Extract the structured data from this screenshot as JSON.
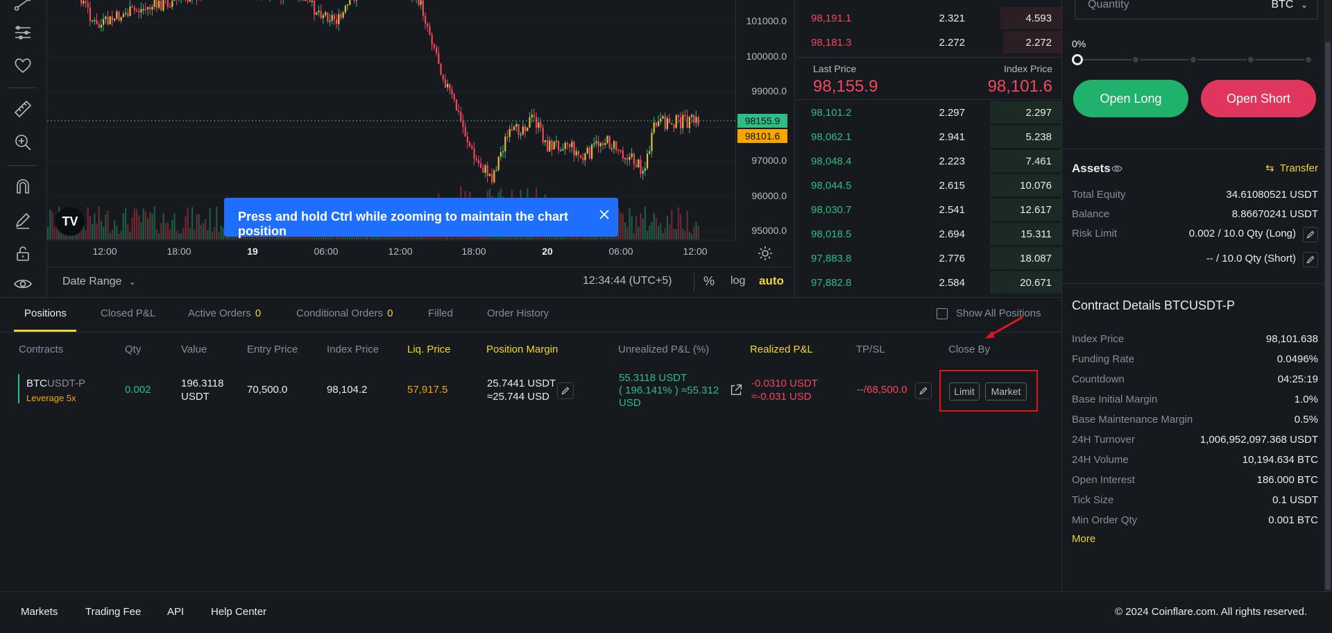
{
  "toast": {
    "message": "Press and hold Ctrl while zooming to maintain the chart position"
  },
  "chart": {
    "price_ticks": [
      "101000.0",
      "100000.0",
      "99000.0",
      "98155.9",
      "98101.6",
      "97000.0",
      "96000.0",
      "95000.0"
    ],
    "time_ticks": [
      "12:00",
      "18:00",
      "19",
      "06:00",
      "12:00",
      "18:00",
      "20",
      "06:00",
      "12:00"
    ],
    "date_range_label": "Date Range",
    "clock": "12:34:44 (UTC+5)",
    "pct_label": "%",
    "log_label": "log",
    "auto_label": "auto",
    "logo_text": "TV",
    "colors": {
      "up": "#2ebd85",
      "down": "#f6465d",
      "candle_up": "#e8b93b",
      "candle_down": "#f6465d"
    }
  },
  "orderbook": {
    "asks": [
      {
        "price": "98,191.1",
        "size": "2.321",
        "total": "4.593",
        "depth": 0.23
      },
      {
        "price": "98,181.3",
        "size": "2.272",
        "total": "2.272",
        "depth": 0.22
      }
    ],
    "last_price_label": "Last Price",
    "last_price": "98,155.9",
    "index_price_label": "Index Price",
    "index_price": "98,101.6",
    "bids": [
      {
        "price": "98,101.2",
        "size": "2.297",
        "total": "2.297",
        "depth": 0.27
      },
      {
        "price": "98,062.1",
        "size": "2.941",
        "total": "5.238",
        "depth": 0.27
      },
      {
        "price": "98,048.4",
        "size": "2.223",
        "total": "7.461",
        "depth": 0.27
      },
      {
        "price": "98,044.5",
        "size": "2.615",
        "total": "10.076",
        "depth": 0.27
      },
      {
        "price": "98,030.7",
        "size": "2.541",
        "total": "12.617",
        "depth": 0.27
      },
      {
        "price": "98,018.5",
        "size": "2.694",
        "total": "15.311",
        "depth": 0.27
      },
      {
        "price": "97,883.8",
        "size": "2.776",
        "total": "18.087",
        "depth": 0.27
      },
      {
        "price": "97,882.8",
        "size": "2.584",
        "total": "20.671",
        "depth": 0.27
      }
    ]
  },
  "order_form": {
    "quantity_placeholder": "Quantity",
    "quantity_unit": "BTC",
    "slider_label": "0%",
    "slider_value": 0,
    "open_long": "Open Long",
    "open_short": "Open Short"
  },
  "assets": {
    "title": "Assets",
    "transfer_label": "Transfer",
    "rows": [
      {
        "label": "Total Equity",
        "value": "34.61080521 USDT"
      },
      {
        "label": "Balance",
        "value": "8.86670241 USDT"
      },
      {
        "label": "Risk Limit",
        "value": "0.002 / 10.0 Qty (Long)"
      },
      {
        "label": "",
        "value": "-- / 10.0 Qty (Short)"
      }
    ]
  },
  "contract_details": {
    "title": "Contract Details BTCUSDT-P",
    "rows": [
      {
        "label": "Index Price",
        "value": "98,101.638"
      },
      {
        "label": "Funding Rate",
        "value": "0.0496%"
      },
      {
        "label": "Countdown",
        "value": "04:25:19"
      },
      {
        "label": "Base Initial Margin",
        "value": "1.0%"
      },
      {
        "label": "Base Maintenance Margin",
        "value": "0.5%"
      },
      {
        "label": "24H Turnover",
        "value": "1,006,952,097.368 USDT"
      },
      {
        "label": "24H Volume",
        "value": "10,194.634 BTC"
      },
      {
        "label": "Open Interest",
        "value": "186.000 BTC"
      },
      {
        "label": "Tick Size",
        "value": "0.1 USDT"
      },
      {
        "label": "Min Order Qty",
        "value": "0.001 BTC"
      }
    ],
    "more_label": "More"
  },
  "positions": {
    "tabs": [
      {
        "label": "Positions",
        "badge": ""
      },
      {
        "label": "Closed P&L",
        "badge": ""
      },
      {
        "label": "Active Orders",
        "badge": "0"
      },
      {
        "label": "Conditional Orders",
        "badge": "0"
      },
      {
        "label": "Filled",
        "badge": ""
      },
      {
        "label": "Order History",
        "badge": ""
      }
    ],
    "show_all_label": "Show All Positions",
    "columns": [
      "Contracts",
      "Qty",
      "Value",
      "Entry Price",
      "Index Price",
      "Liq. Price",
      "Position Margin",
      "Unrealized P&L (%)",
      "Realized P&L",
      "TP/SL",
      "Close By"
    ],
    "row": {
      "contract_base": "BTC",
      "contract_quote": "USDT-P",
      "leverage": "Leverage 5x",
      "qty": "0.002",
      "value_line1": "196.3118",
      "value_line2": "USDT",
      "entry_price": "70,500.0",
      "index_price": "98,104.2",
      "liq_price": "57,917.5",
      "margin_line1": "25.7441 USDT",
      "margin_line2": "≈25.744 USD",
      "upnl_line1": "55.3118 USDT",
      "upnl_line2": "( 196.141% ) ≈55.312",
      "upnl_line3": "USD",
      "rpnl_line1": "-0.0310 USDT",
      "rpnl_line2": "≈-0.031 USD",
      "tpsl_tp": "--",
      "tpsl_sl": "/68,500.0",
      "close_limit": "Limit",
      "close_market": "Market"
    }
  },
  "footer": {
    "links": [
      "Markets",
      "Trading Fee",
      "API",
      "Help Center"
    ],
    "copyright": "2024 Coinflare.com. All rights reserved."
  }
}
